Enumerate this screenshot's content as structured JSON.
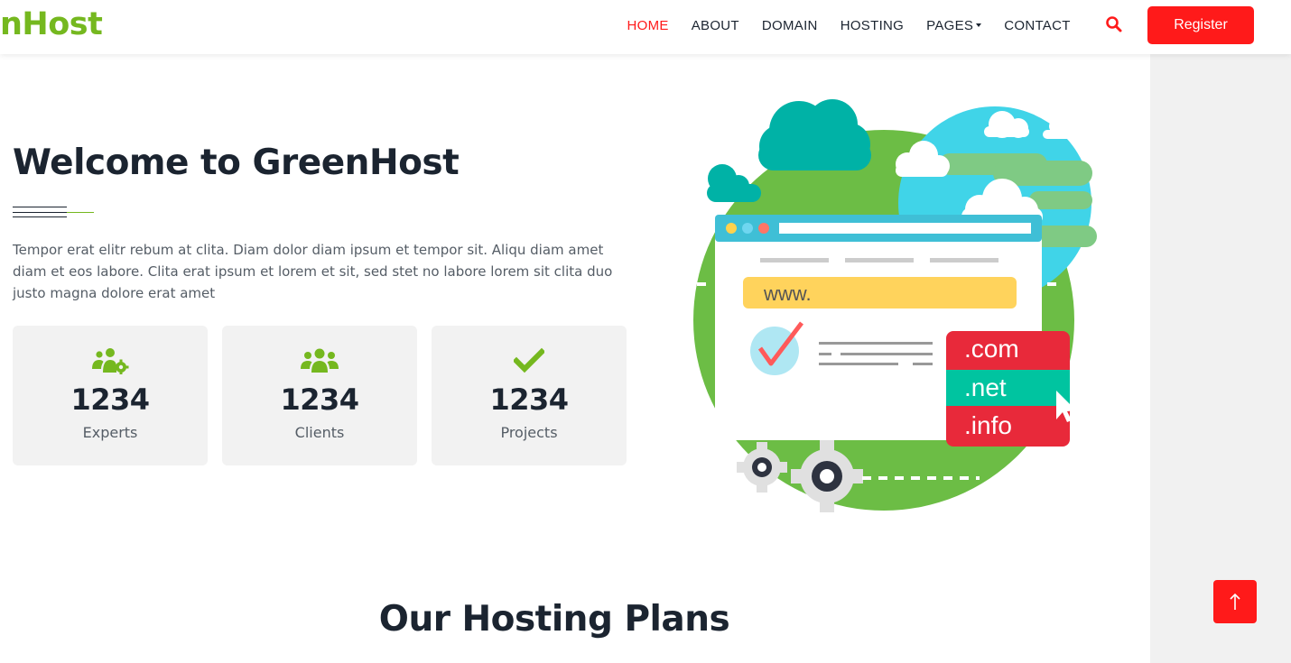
{
  "brand": {
    "name": "nHost",
    "color": "#75b81f"
  },
  "nav": {
    "items": [
      {
        "label": "HOME",
        "active": true
      },
      {
        "label": "ABOUT",
        "active": false
      },
      {
        "label": "DOMAIN",
        "active": false
      },
      {
        "label": "HOSTING",
        "active": false
      },
      {
        "label": "PAGES",
        "active": false,
        "dropdown": true
      },
      {
        "label": "CONTACT",
        "active": false
      }
    ],
    "search_icon": "search-icon",
    "register_label": "Register"
  },
  "hero": {
    "title": "Welcome to GreenHost",
    "text": "Tempor erat elitr rebum at clita. Diam dolor diam ipsum et tempor sit. Aliqu diam amet diam et eos labore. Clita erat ipsum et lorem et sit, sed stet no labore lorem sit clita duo justo magna dolore erat amet"
  },
  "stats": [
    {
      "icon": "users-cog-icon",
      "number": "1234",
      "label": "Experts"
    },
    {
      "icon": "users-icon",
      "number": "1234",
      "label": "Clients"
    },
    {
      "icon": "check-icon",
      "number": "1234",
      "label": "Projects"
    }
  ],
  "illustration": {
    "url_text": "www.",
    "domains": [
      ".com",
      ".net",
      ".info"
    ]
  },
  "section": {
    "title": "Our Hosting Plans"
  },
  "colors": {
    "accent": "#ff1a1a",
    "green": "#75b81f",
    "dark": "#1b2430"
  }
}
